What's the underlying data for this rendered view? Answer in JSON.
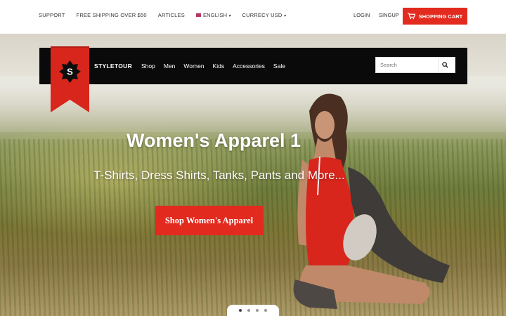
{
  "topbar": {
    "links": [
      "SUPPORT",
      "FREE SHIPPING OVER $50",
      "ARTICLES"
    ],
    "language": "ENGLISH",
    "currency": "CURRECY USD",
    "login": "LOGIN",
    "signup": "SINGUP",
    "cart": "SHOPPING CART"
  },
  "nav": {
    "logo_letter": "S",
    "brand": "STYLETOUR",
    "items": [
      "Shop",
      "Men",
      "Women",
      "Kids",
      "Accessories",
      "Sale"
    ],
    "search_placeholder": "Search"
  },
  "hero": {
    "title": "Women's Apparel 1",
    "subtitle": "T-Shirts, Dress Shirts, Tanks, Pants and More...",
    "cta": "Shop Women's Apparel",
    "slides": 4,
    "active_slide": 1
  },
  "colors": {
    "accent": "#e22a1f",
    "navbar": "#0a0a0a"
  }
}
